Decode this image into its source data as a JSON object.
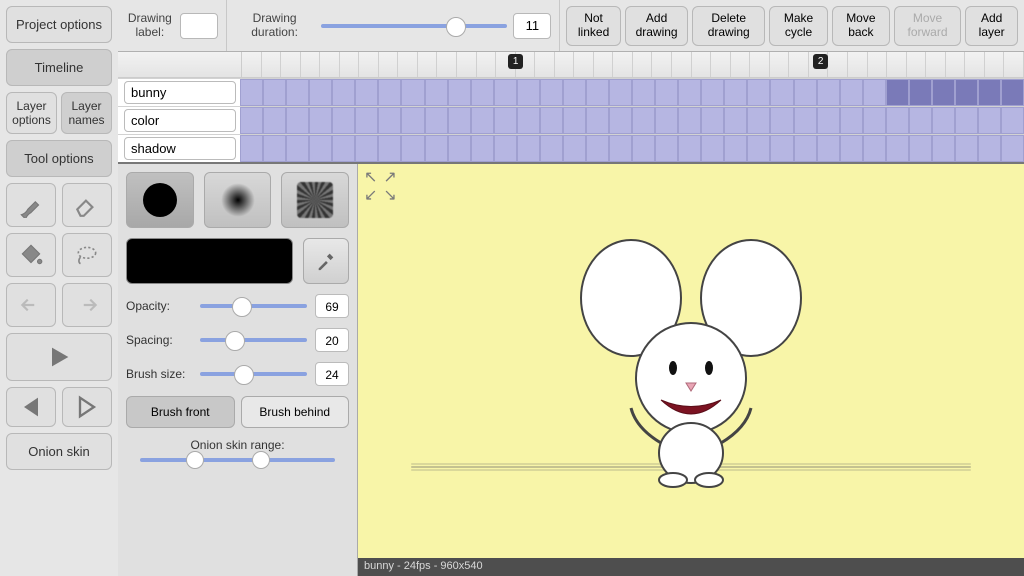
{
  "sidebar": {
    "project_options": "Project options",
    "timeline": "Timeline",
    "layer_options": "Layer options",
    "layer_names": "Layer names",
    "tool_options": "Tool options",
    "onion_skin": "Onion skin"
  },
  "topbar": {
    "drawing_label": "Drawing label:",
    "drawing_label_value": "",
    "drawing_duration": "Drawing duration:",
    "duration_value": "11",
    "not_linked": "Not linked",
    "add_drawing": "Add drawing",
    "delete_drawing": "Delete drawing",
    "make_cycle": "Make cycle",
    "move_back": "Move back",
    "move_forward": "Move forward",
    "add_layer": "Add layer"
  },
  "timeline": {
    "frame_markers": [
      "1",
      "2"
    ],
    "layers": [
      "bunny",
      "color",
      "shadow"
    ]
  },
  "tool_panel": {
    "opacity_label": "Opacity:",
    "opacity_value": "69",
    "spacing_label": "Spacing:",
    "spacing_value": "20",
    "brushsize_label": "Brush size:",
    "brushsize_value": "24",
    "brush_front": "Brush front",
    "brush_behind": "Brush behind",
    "onion_range": "Onion skin range:"
  },
  "status": "bunny - 24fps - 960x540"
}
